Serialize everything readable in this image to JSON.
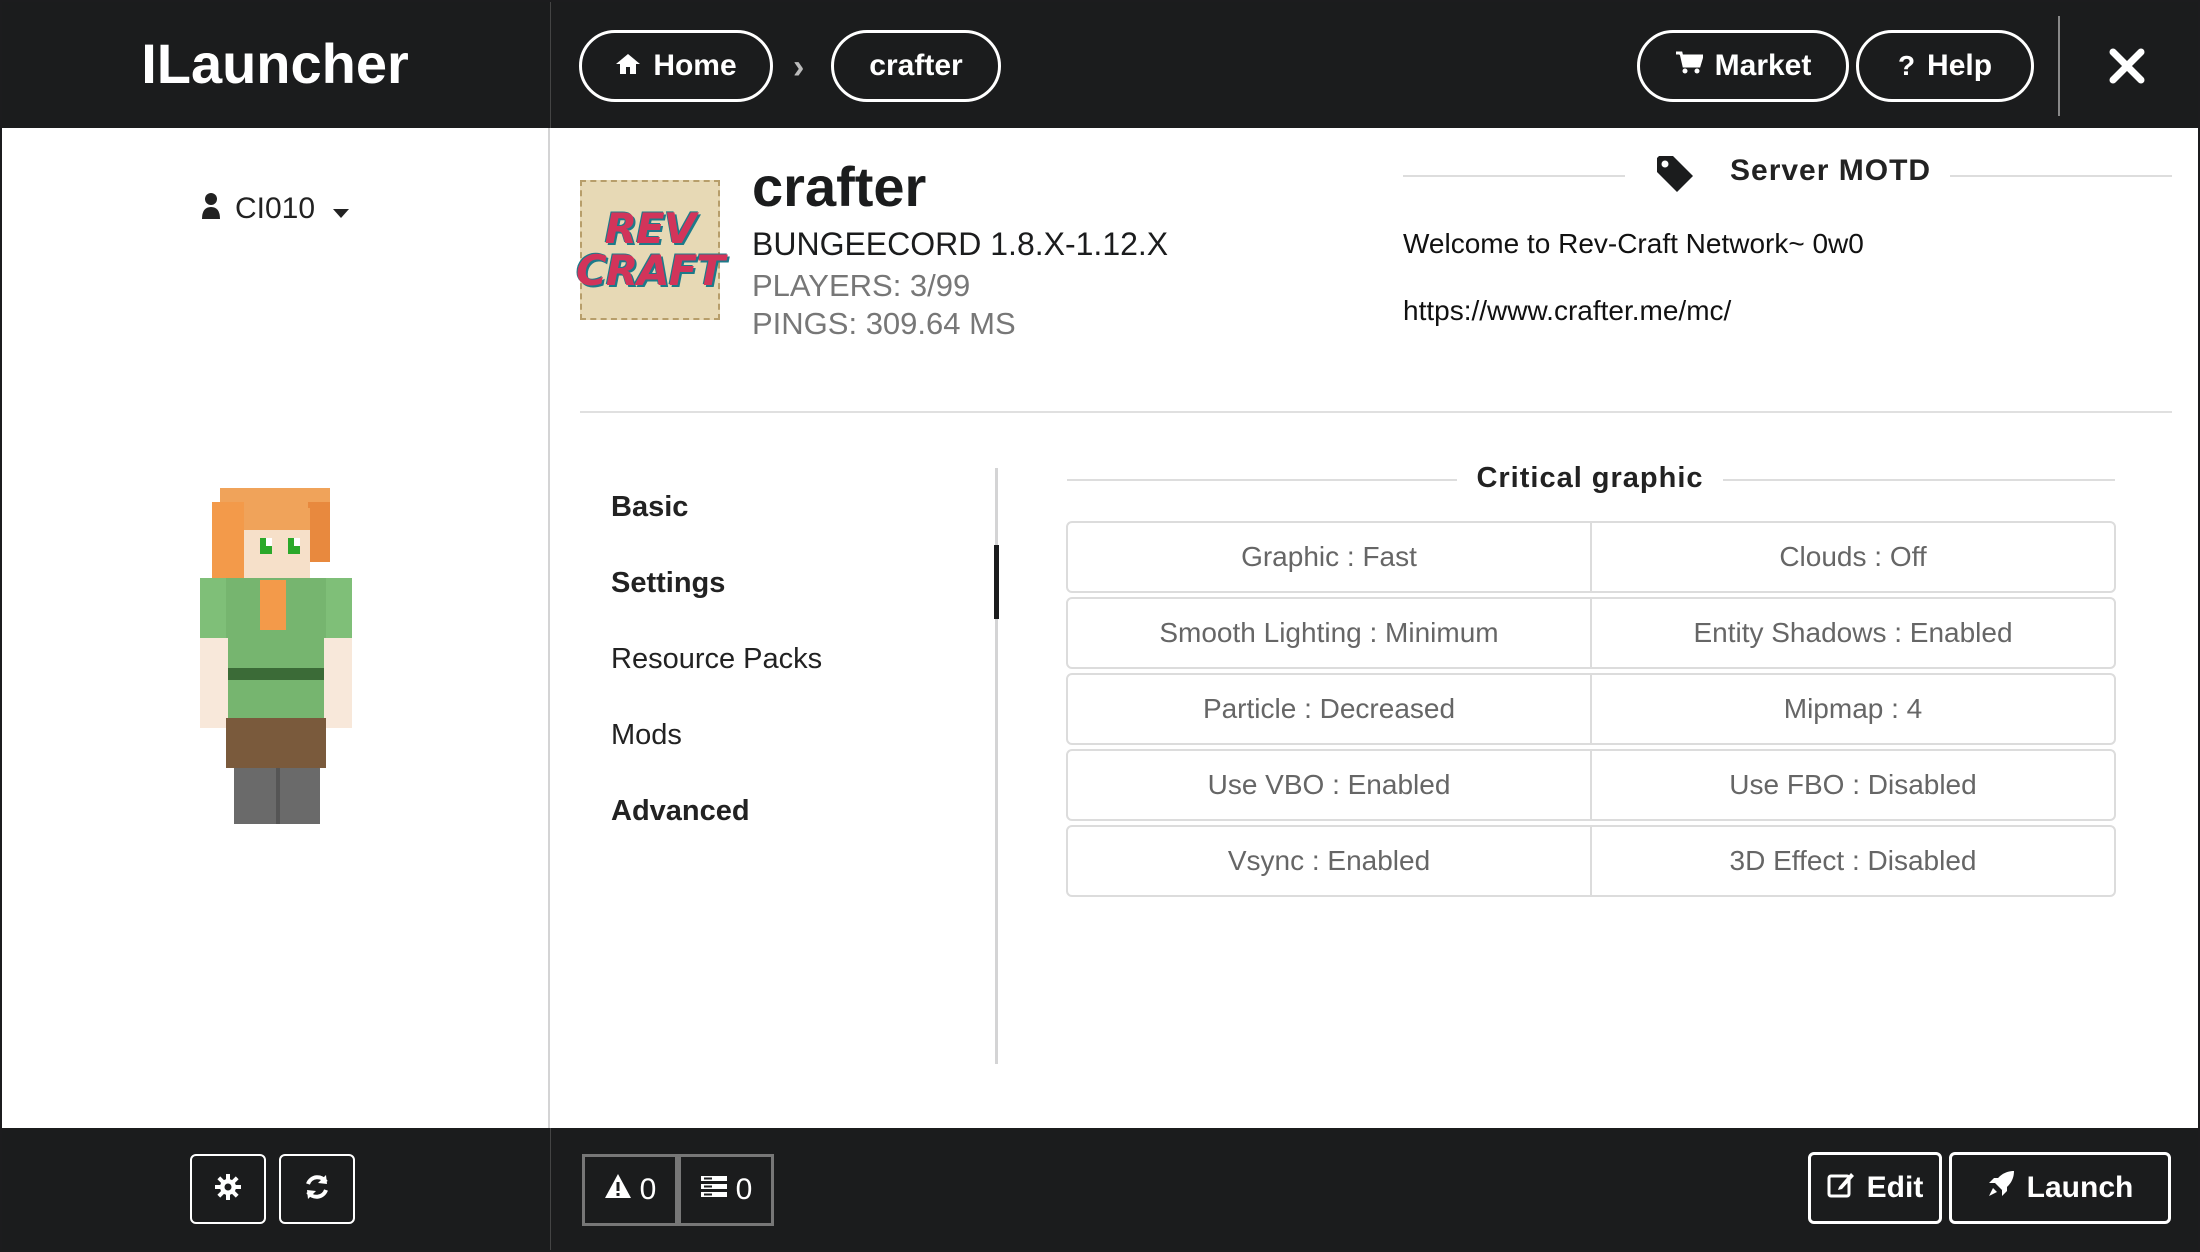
{
  "app": {
    "title": "ILauncher"
  },
  "user": {
    "name": "CI010"
  },
  "nav": {
    "home_label": "Home",
    "crumb_label": "crafter",
    "market_label": "Market",
    "help_label": "Help"
  },
  "server": {
    "name": "crafter",
    "logo_line1": "REV",
    "logo_line2": "CRAFT",
    "version": "BUNGEECORD 1.8.X-1.12.X",
    "players": "PLAYERS: 3/99",
    "ping": "PINGS: 309.64 MS"
  },
  "motd": {
    "title": "Server MOTD",
    "line1": "Welcome to Rev-Craft Network~ 0w0",
    "line2": "https://www.crafter.me/mc/"
  },
  "menu": {
    "items": [
      {
        "label": "Basic"
      },
      {
        "label": "Settings"
      },
      {
        "label": "Resource Packs"
      },
      {
        "label": "Mods"
      },
      {
        "label": "Advanced"
      }
    ],
    "active": "Settings"
  },
  "graphics": {
    "title": "Critical graphic",
    "rows": [
      [
        "Graphic : Fast",
        "Clouds : Off"
      ],
      [
        "Smooth Lighting : Minimum",
        "Entity Shadows : Enabled"
      ],
      [
        "Particle : Decreased",
        "Mipmap : 4"
      ],
      [
        "Use VBO : Enabled",
        "Use FBO : Disabled"
      ],
      [
        "Vsync : Enabled",
        "3D Effect : Disabled"
      ]
    ]
  },
  "footer": {
    "warnings_count": "0",
    "tasks_count": "0",
    "edit_label": "Edit",
    "launch_label": "Launch"
  },
  "colors": {
    "dark": "#1b1c1d",
    "muted_text": "#777777"
  }
}
